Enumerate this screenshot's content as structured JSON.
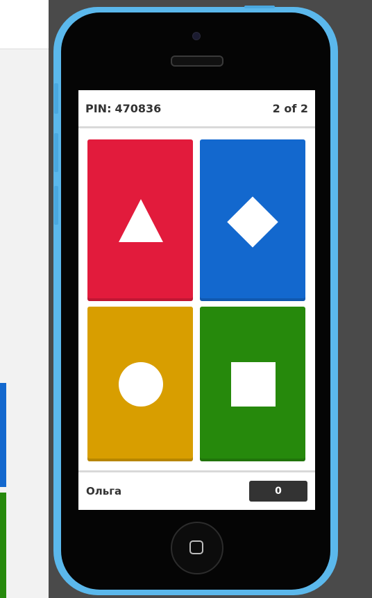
{
  "game": {
    "pin_label": "PIN:",
    "pin_value": "470836",
    "question_counter": "2 of 2"
  },
  "answers": [
    {
      "shape": "triangle-icon",
      "color": "#e21b3c"
    },
    {
      "shape": "diamond-icon",
      "color": "#1368ce"
    },
    {
      "shape": "circle-icon",
      "color": "#d89e00"
    },
    {
      "shape": "square-icon",
      "color": "#26890c"
    }
  ],
  "player": {
    "name": "Ольга",
    "score": "0"
  },
  "colors": {
    "phone_frame": "#5bb8ec",
    "background": "#4a4a4a",
    "score_box": "#333333"
  }
}
